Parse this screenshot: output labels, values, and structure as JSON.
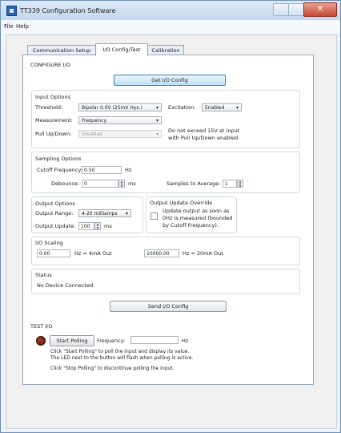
{
  "window": {
    "title": "TT339 Configuration Software",
    "close_glyph": "✕"
  },
  "menu": {
    "items": [
      "File",
      "Help"
    ]
  },
  "tabs": [
    {
      "label": "Communication Setup"
    },
    {
      "label": "I/O Config/Test"
    },
    {
      "label": "Calibration"
    }
  ],
  "configure": {
    "title": "CONFIGURE I/O",
    "get_button": "Get I/O Config",
    "send_button": "Send I/O Config"
  },
  "input_options": {
    "title": "Input Options",
    "threshold_label": "Threshold:",
    "threshold_value": "Bipolar 0.0V (25mV Hys.)",
    "excitation_label": "Excitation:",
    "excitation_value": "Enabled",
    "measurement_label": "Measurement:",
    "measurement_value": "Frequency",
    "pullupdown_label": "Pull Up/Down:",
    "pullupdown_value": "Disabled",
    "warning_line1": "Do not exceed 15V at input",
    "warning_line2": "with Pull Up/Down enabled."
  },
  "sampling_options": {
    "title": "Sampling Options",
    "cutoff_label": "Cutoff Frequency:",
    "cutoff_value": "0.50",
    "cutoff_unit": "Hz",
    "debounce_label": "Debounce:",
    "debounce_value": "0",
    "debounce_unit": "ms",
    "samples_label": "Samples to Average:",
    "samples_value": "1"
  },
  "output_options": {
    "title": "Output Options",
    "range_label": "Output Range:",
    "range_value": "4-20 milliamps",
    "update_label": "Output Update:",
    "update_value": "100",
    "update_unit": "ms"
  },
  "output_override": {
    "title": "Output Update Override",
    "line1": "Update output as soon as",
    "line2": "0Hz is measured (bounded",
    "line3": "by Cutoff Frequency)."
  },
  "io_scaling": {
    "title": "I/O Scaling",
    "low_value": "0.00",
    "low_text": "Hz = 4mA Out",
    "high_value": "10000.00",
    "high_text": "Hz = 20mA Out"
  },
  "status": {
    "title": "Status",
    "text": "No Device Connected"
  },
  "test_io": {
    "title": "TEST I/O",
    "start_button": "Start Polling",
    "frequency_label": "Frequency:",
    "frequency_value": "",
    "frequency_unit": "Hz",
    "help1": "Click \"Start Polling\" to poll the input and display its value.",
    "help2": "The LED next to the button will flash when polling is active.",
    "help3": "Click \"Stop Polling\" to discontinue polling the input."
  },
  "icons": {
    "dropdown": "▾",
    "spin_up": "▲",
    "spin_down": "▼"
  }
}
